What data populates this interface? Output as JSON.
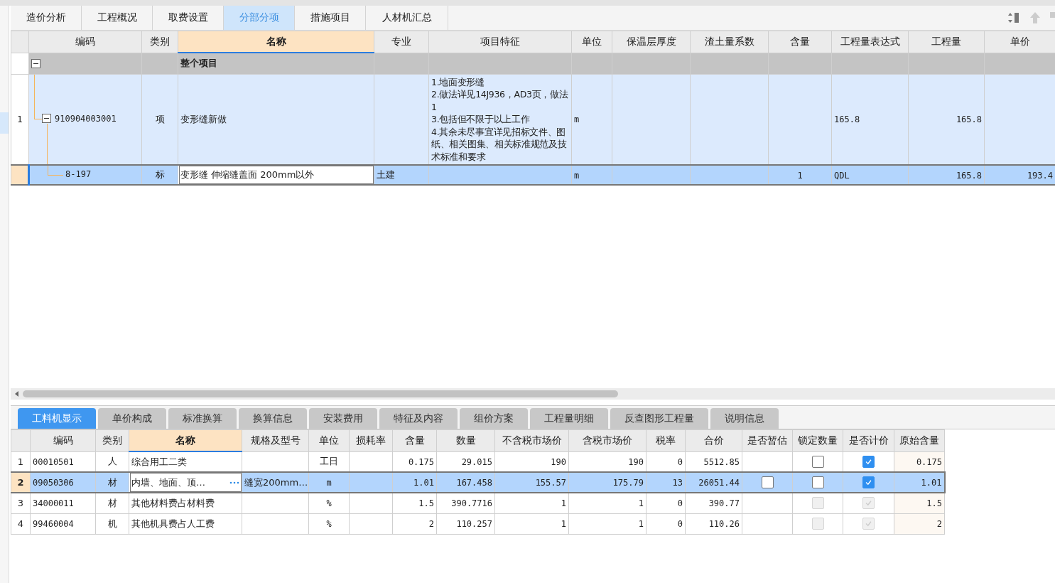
{
  "main_tabs": [
    {
      "label": "造价分析",
      "selected": false
    },
    {
      "label": "工程概况",
      "selected": false
    },
    {
      "label": "取费设置",
      "selected": false
    },
    {
      "label": "分部分项",
      "selected": true
    },
    {
      "label": "措施项目",
      "selected": false
    },
    {
      "label": "人材机汇总",
      "selected": false
    }
  ],
  "upper_table": {
    "columns": [
      "编码",
      "类别",
      "名称",
      "专业",
      "项目特征",
      "单位",
      "保温层厚度",
      "渣土量系数",
      "含量",
      "工程量表达式",
      "工程量",
      "单价"
    ],
    "rows": [
      {
        "kind": "group",
        "expanded": true,
        "name": "整个项目",
        "selected": false
      },
      {
        "kind": "item",
        "index": "1",
        "expanded": true,
        "code": "910904003001",
        "type": "项",
        "name": "变形缝新做",
        "features": [
          "1.地面变形缝",
          "2.做法详见14J936，AD3页，做法1",
          "3.包括但不限于以上工作",
          "4.其余未尽事宜详见招标文件、图纸、相关图集、相关标准规范及技术标准和要求"
        ],
        "unit": "m",
        "expr": "165.8",
        "quantity": "165.8",
        "selected": false
      },
      {
        "kind": "norm",
        "code": "8-197",
        "type": "标",
        "name": "变形缝 伸缩缝盖面 200mm以外",
        "major": "土建",
        "unit": "m",
        "content": "1",
        "expr": "QDL",
        "quantity": "165.8",
        "price": "193.4",
        "selected": true
      }
    ]
  },
  "bottom_tabs": [
    {
      "label": "工料机显示",
      "selected": true
    },
    {
      "label": "单价构成",
      "selected": false
    },
    {
      "label": "标准换算",
      "selected": false
    },
    {
      "label": "换算信息",
      "selected": false
    },
    {
      "label": "安装费用",
      "selected": false
    },
    {
      "label": "特征及内容",
      "selected": false
    },
    {
      "label": "组价方案",
      "selected": false
    },
    {
      "label": "工程量明细",
      "selected": false
    },
    {
      "label": "反查图形工程量",
      "selected": false
    },
    {
      "label": "说明信息",
      "selected": false
    }
  ],
  "lower_table": {
    "columns": [
      "编码",
      "类别",
      "名称",
      "规格及型号",
      "单位",
      "损耗率",
      "含量",
      "数量",
      "不含税市场价",
      "含税市场价",
      "税率",
      "合价",
      "是否暂估",
      "锁定数量",
      "是否计价",
      "原始含量"
    ],
    "rows": [
      {
        "index": "1",
        "code": "00010501",
        "type": "人",
        "name": "综合用工二类",
        "unit": "工日",
        "content": "0.175",
        "quantity": "29.015",
        "price_ex": "190",
        "price_in": "190",
        "tax": "0",
        "total": "5512.85",
        "locked": {
          "checked": false,
          "disabled": false
        },
        "priced": {
          "checked": true,
          "disabled": false
        },
        "original": "0.175",
        "selected": false
      },
      {
        "index": "2",
        "code": "09050306",
        "type": "材",
        "name": "内墙、地面、顶…",
        "spec": "缝宽200mm…",
        "unit": "m",
        "content": "1.01",
        "quantity": "167.458",
        "price_ex": "155.57",
        "price_in": "175.79",
        "tax": "13",
        "total": "26051.44",
        "provisional": {
          "checked": false,
          "disabled": false
        },
        "locked": {
          "checked": false,
          "disabled": false
        },
        "priced": {
          "checked": true,
          "disabled": false
        },
        "original": "1.01",
        "selected": true
      },
      {
        "index": "3",
        "code": "34000011",
        "type": "材",
        "name": "其他材料费占材料费",
        "unit": "%",
        "content": "1.5",
        "quantity": "390.7716",
        "price_ex": "1",
        "price_in": "1",
        "tax": "0",
        "total": "390.77",
        "locked": {
          "checked": false,
          "disabled": true
        },
        "priced": {
          "checked": true,
          "disabled": true
        },
        "original": "1.5",
        "selected": false
      },
      {
        "index": "4",
        "code": "99460004",
        "type": "机",
        "name": "其他机具费占人工费",
        "unit": "%",
        "content": "2",
        "quantity": "110.257",
        "price_ex": "1",
        "price_in": "1",
        "tax": "0",
        "total": "110.26",
        "locked": {
          "checked": false,
          "disabled": true
        },
        "priced": {
          "checked": true,
          "disabled": true
        },
        "original": "2",
        "selected": false
      }
    ]
  }
}
